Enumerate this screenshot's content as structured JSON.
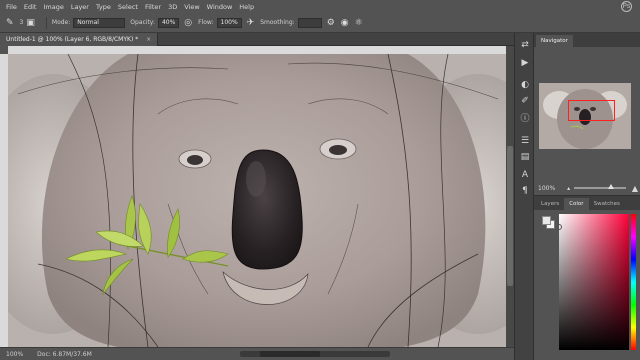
{
  "menu": {
    "items": [
      "File",
      "Edit",
      "Image",
      "Layer",
      "Type",
      "Select",
      "Filter",
      "3D",
      "View",
      "Window",
      "Help"
    ],
    "app_logo": "Ps"
  },
  "options_bar": {
    "brush_size": "3",
    "mode_label": "Mode:",
    "mode_value": "Normal",
    "opacity_label": "Opacity:",
    "opacity_value": "40%",
    "flow_label": "Flow:",
    "flow_value": "100%",
    "smoothing_label": "Smoothing:",
    "smoothing_value": ""
  },
  "document": {
    "tab_title": "Untitled-1 @ 100% (Layer 6, RGB/8/CMYK) *",
    "close_symbol": "×"
  },
  "status": {
    "zoom": "100%",
    "doc_info": "Doc: 6.87M/37.6M"
  },
  "navigator": {
    "tab_label": "Navigator",
    "zoom": "100%"
  },
  "color_panel": {
    "tabs": [
      "Layers",
      "Color",
      "Swatches"
    ],
    "active_tab": "Color"
  },
  "colors": {
    "fur": "#b0a4a0",
    "nose": "#2a2426",
    "leaf": "#a9c64a",
    "view_box": "#ff2020"
  }
}
